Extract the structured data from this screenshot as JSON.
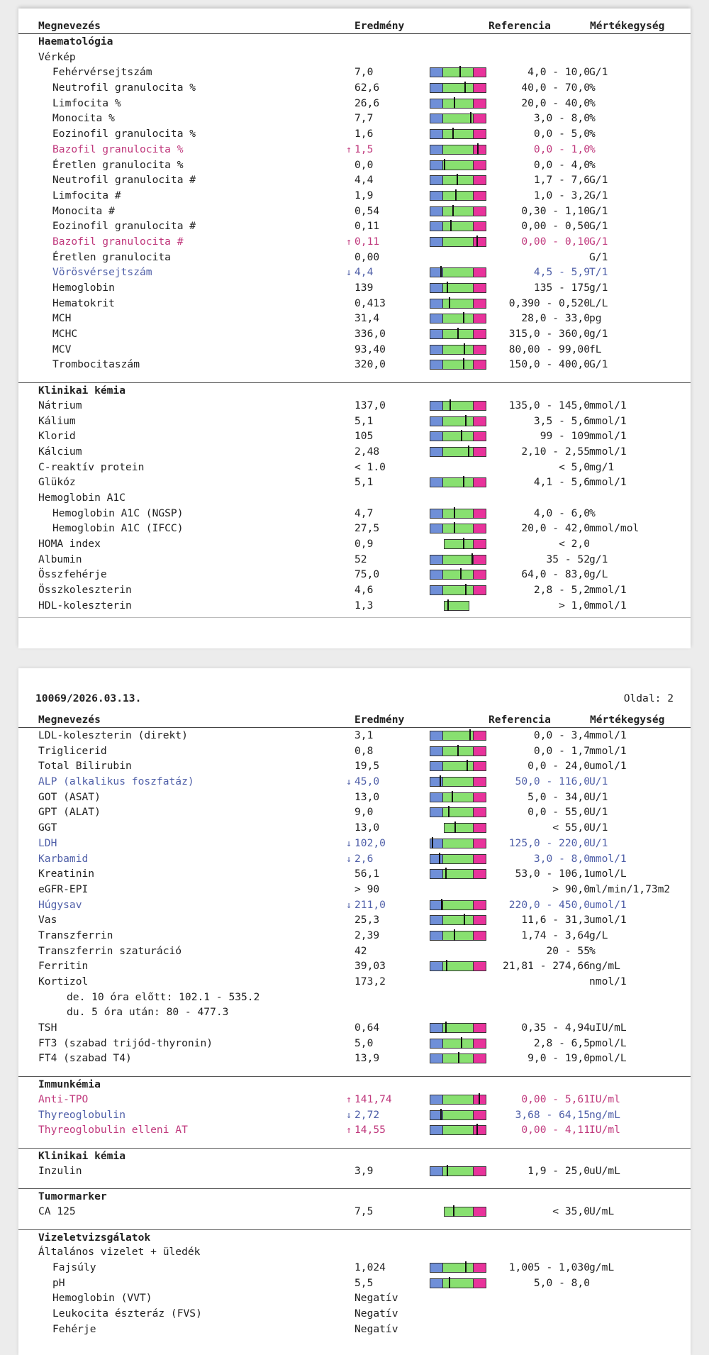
{
  "columns": {
    "name": "Megnevezés",
    "result": "Eredmény",
    "reference": "Referencia",
    "unit": "Mértékegység"
  },
  "page1": {
    "rows": [
      {
        "kind": "category",
        "name": "Haematológia"
      },
      {
        "kind": "group",
        "name": "Vérkép"
      },
      {
        "kind": "item",
        "indent": 1,
        "name": "Fehérvérsejtszám",
        "result": "7,0",
        "ref": "4,0 - 10,0",
        "unit": "G/1",
        "bar": "full",
        "level": 0.55
      },
      {
        "kind": "item",
        "indent": 1,
        "name": "Neutrofil granulocita %",
        "result": "62,6",
        "ref": "40,0 - 70,0",
        "unit": "%",
        "bar": "full",
        "level": 0.73
      },
      {
        "kind": "item",
        "indent": 1,
        "name": "Limfocita %",
        "result": "26,6",
        "ref": "20,0 - 40,0",
        "unit": "%",
        "bar": "full",
        "level": 0.36
      },
      {
        "kind": "item",
        "indent": 1,
        "name": "Monocita %",
        "result": "7,7",
        "ref": "3,0 - 8,0",
        "unit": "%",
        "bar": "full",
        "level": 0.93
      },
      {
        "kind": "item",
        "indent": 1,
        "name": "Eozinofil granulocita %",
        "result": "1,6",
        "ref": "0,0 - 5,0",
        "unit": "%",
        "bar": "full",
        "level": 0.3
      },
      {
        "kind": "item",
        "indent": 1,
        "name": "Bazofil granulocita %",
        "result": "1,5",
        "ref": "0,0 - 1,0",
        "unit": "%",
        "bar": "full",
        "level": 1.1,
        "flag": "↑",
        "status": "high"
      },
      {
        "kind": "item",
        "indent": 1,
        "name": "Éretlen granulocita %",
        "result": "0,0",
        "ref": "0,0 - 4,0",
        "unit": "%",
        "bar": "full",
        "level": 0.0
      },
      {
        "kind": "item",
        "indent": 1,
        "name": "Neutrofil granulocita #",
        "result": "4,4",
        "ref": "1,7 - 7,6",
        "unit": "G/1",
        "bar": "full",
        "level": 0.46
      },
      {
        "kind": "item",
        "indent": 1,
        "name": "Limfocita #",
        "result": "1,9",
        "ref": "1,0 - 3,2",
        "unit": "G/1",
        "bar": "full",
        "level": 0.41
      },
      {
        "kind": "item",
        "indent": 1,
        "name": "Monocita #",
        "result": "0,54",
        "ref": "0,30 - 1,10",
        "unit": "G/1",
        "bar": "full",
        "level": 0.3
      },
      {
        "kind": "item",
        "indent": 1,
        "name": "Eozinofil granulocita #",
        "result": "0,11",
        "ref": "0,00 - 0,50",
        "unit": "G/1",
        "bar": "full",
        "level": 0.22
      },
      {
        "kind": "item",
        "indent": 1,
        "name": "Bazofil granulocita #",
        "result": "0,11",
        "ref": "0,00 - 0,10",
        "unit": "G/1",
        "bar": "full",
        "level": 1.08,
        "flag": "↑",
        "status": "high"
      },
      {
        "kind": "item",
        "indent": 1,
        "name": "Éretlen granulocita",
        "result": "0,00",
        "ref": "",
        "unit": "G/1",
        "bar": "none"
      },
      {
        "kind": "item",
        "indent": 1,
        "name": "Vörösvérsejtszám",
        "result": "4,4",
        "ref": "4,5 - 5,9",
        "unit": "T/1",
        "bar": "full",
        "level": -0.05,
        "flag": "↓",
        "status": "low"
      },
      {
        "kind": "item",
        "indent": 1,
        "name": "Hemoglobin",
        "result": "139",
        "ref": "135 - 175",
        "unit": "g/1",
        "bar": "full",
        "level": 0.1
      },
      {
        "kind": "item",
        "indent": 1,
        "name": "Hematokrit",
        "result": "0,413",
        "ref": "0,390 - 0,520",
        "unit": "L/L",
        "bar": "full",
        "level": 0.18
      },
      {
        "kind": "item",
        "indent": 1,
        "name": "MCH",
        "result": "31,4",
        "ref": "28,0 - 33,0",
        "unit": "pg",
        "bar": "full",
        "level": 0.68
      },
      {
        "kind": "item",
        "indent": 1,
        "name": "MCHC",
        "result": "336,0",
        "ref": "315,0 - 360,0",
        "unit": "g/1",
        "bar": "full",
        "level": 0.47
      },
      {
        "kind": "item",
        "indent": 1,
        "name": "MCV",
        "result": "93,40",
        "ref": "80,00 - 99,00",
        "unit": "fL",
        "bar": "full",
        "level": 0.7
      },
      {
        "kind": "item",
        "indent": 1,
        "name": "Trombocitaszám",
        "result": "320,0",
        "ref": "150,0 - 400,0",
        "unit": "G/1",
        "bar": "full",
        "level": 0.68
      },
      {
        "kind": "category",
        "name": "Klinikai kémia",
        "gap": true
      },
      {
        "kind": "item",
        "indent": 0,
        "name": "Nátrium",
        "result": "137,0",
        "ref": "135,0 - 145,0",
        "unit": "mmol/1",
        "bar": "full",
        "level": 0.2
      },
      {
        "kind": "item",
        "indent": 0,
        "name": "Kálium",
        "result": "5,1",
        "ref": "3,5 - 5,6",
        "unit": "mmol/1",
        "bar": "full",
        "level": 0.76
      },
      {
        "kind": "item",
        "indent": 0,
        "name": "Klorid",
        "result": "105",
        "ref": "99 - 109",
        "unit": "mmol/1",
        "bar": "full",
        "level": 0.6
      },
      {
        "kind": "item",
        "indent": 0,
        "name": "Kálcium",
        "result": "2,48",
        "ref": "2,10 - 2,55",
        "unit": "mmol/1",
        "bar": "full",
        "level": 0.84
      },
      {
        "kind": "item",
        "indent": 0,
        "name": "C-reaktív protein",
        "result": "< 1.0",
        "ref": "< 5,0",
        "unit": "mg/1",
        "bar": "none"
      },
      {
        "kind": "item",
        "indent": 0,
        "name": "Glükóz",
        "result": "5,1",
        "ref": "4,1 - 5,6",
        "unit": "mmol/1",
        "bar": "full",
        "level": 0.67
      },
      {
        "kind": "group",
        "indent": 0,
        "name": "Hemoglobin A1C"
      },
      {
        "kind": "item",
        "indent": 1,
        "name": "Hemoglobin A1C (NGSP)",
        "result": "4,7",
        "ref": "4,0 - 6,0",
        "unit": "%",
        "bar": "full",
        "level": 0.35
      },
      {
        "kind": "item",
        "indent": 1,
        "name": "Hemoglobin A1C (IFCC)",
        "result": "27,5",
        "ref": "20,0 - 42,0",
        "unit": "mmol/mol",
        "bar": "full",
        "level": 0.34
      },
      {
        "kind": "item",
        "indent": 0,
        "name": "HOMA index",
        "result": "0,9",
        "ref": "< 2,0",
        "unit": "",
        "bar": "nolow",
        "level": 0.45
      },
      {
        "kind": "item",
        "indent": 0,
        "name": "Albumin",
        "result": "52",
        "ref": "35 - 52",
        "unit": "g/1",
        "bar": "full",
        "level": 0.98
      },
      {
        "kind": "item",
        "indent": 0,
        "name": "Összfehérje",
        "result": "75,0",
        "ref": "64,0 - 83,0",
        "unit": "g/L",
        "bar": "full",
        "level": 0.58
      },
      {
        "kind": "item",
        "indent": 0,
        "name": "Összkoleszterin",
        "result": "4,6",
        "ref": "2,8 - 5,2",
        "unit": "mmol/1",
        "bar": "full",
        "level": 0.75
      },
      {
        "kind": "item",
        "indent": 0,
        "name": "HDL-koleszterin",
        "result": "1,3",
        "ref": "> 1,0",
        "unit": "mmol/1",
        "bar": "nohigh",
        "level": 0.12
      }
    ]
  },
  "page2": {
    "doc_id": "10069/2026.03.13.",
    "page_label": "Oldal: 2",
    "rows": [
      {
        "kind": "item",
        "indent": 0,
        "name": "LDL-koleszterin (direkt)",
        "result": "3,1",
        "ref": "0,0 - 3,4",
        "unit": "mmol/1",
        "bar": "full",
        "level": 0.9
      },
      {
        "kind": "item",
        "indent": 0,
        "name": "Triglicerid",
        "result": "0,8",
        "ref": "0,0 - 1,7",
        "unit": "mmol/1",
        "bar": "full",
        "level": 0.47
      },
      {
        "kind": "item",
        "indent": 0,
        "name": "Total Bilirubin",
        "result": "19,5",
        "ref": "0,0 - 24,0",
        "unit": "umol/1",
        "bar": "full",
        "level": 0.8
      },
      {
        "kind": "item",
        "indent": 0,
        "name": "ALP (alkalikus foszfatáz)",
        "result": "45,0",
        "ref": "50,0 - 116,0",
        "unit": "U/1",
        "bar": "full",
        "level": -0.07,
        "flag": "↓",
        "status": "low"
      },
      {
        "kind": "item",
        "indent": 0,
        "name": "GOT (ASAT)",
        "result": "13,0",
        "ref": "5,0 - 34,0",
        "unit": "U/1",
        "bar": "full",
        "level": 0.27
      },
      {
        "kind": "item",
        "indent": 0,
        "name": "GPT (ALAT)",
        "result": "9,0",
        "ref": "0,0 - 55,0",
        "unit": "U/1",
        "bar": "full",
        "level": 0.16
      },
      {
        "kind": "item",
        "indent": 0,
        "name": "GGT",
        "result": "13,0",
        "ref": "< 55,0",
        "unit": "U/1",
        "bar": "nolow",
        "level": 0.24
      },
      {
        "kind": "item",
        "indent": 0,
        "name": "LDH",
        "result": "102,0",
        "ref": "125,0 - 220,0",
        "unit": "U/1",
        "bar": "full",
        "level": -0.22,
        "flag": "↓",
        "status": "low"
      },
      {
        "kind": "item",
        "indent": 0,
        "name": "Karbamid",
        "result": "2,6",
        "ref": "3,0 - 8,0",
        "unit": "mmol/1",
        "bar": "full",
        "level": -0.08,
        "flag": "↓",
        "status": "low"
      },
      {
        "kind": "item",
        "indent": 0,
        "name": "Kreatinin",
        "result": "56,1",
        "ref": "53,0 - 106,1",
        "unit": "umol/L",
        "bar": "full",
        "level": 0.06
      },
      {
        "kind": "item",
        "indent": 0,
        "name": "eGFR-EPI",
        "result": "> 90",
        "ref": "> 90,0",
        "unit": "ml/min/1,73m2",
        "bar": "none"
      },
      {
        "kind": "item",
        "indent": 0,
        "name": "Húgysav",
        "result": "211,0",
        "ref": "220,0 - 450,0",
        "unit": "umol/1",
        "bar": "full",
        "level": -0.04,
        "flag": "↓",
        "status": "low"
      },
      {
        "kind": "item",
        "indent": 0,
        "name": "Vas",
        "result": "25,3",
        "ref": "11,6 - 31,3",
        "unit": "umol/1",
        "bar": "full",
        "level": 0.7
      },
      {
        "kind": "item",
        "indent": 0,
        "name": "Transzferrin",
        "result": "2,39",
        "ref": "1,74 - 3,64",
        "unit": "g/L",
        "bar": "full",
        "level": 0.34
      },
      {
        "kind": "item",
        "indent": 0,
        "name": "Transzferrin szaturáció",
        "result": "42",
        "ref": "20 - 55",
        "unit": "%",
        "bar": "none"
      },
      {
        "kind": "item",
        "indent": 0,
        "name": "Ferritin",
        "result": "39,03",
        "ref": "21,81 - 274,66",
        "unit": "ng/mL",
        "bar": "full",
        "level": 0.07
      },
      {
        "kind": "item",
        "indent": 0,
        "name": "Kortizol",
        "result": "173,2",
        "ref": "",
        "unit": "nmol/1",
        "bar": "none"
      },
      {
        "kind": "note",
        "text": "de. 10 óra előtt: 102.1 - 535.2"
      },
      {
        "kind": "note",
        "text": "du. 5 óra után: 80 - 477.3"
      },
      {
        "kind": "item",
        "indent": 0,
        "name": "TSH",
        "result": "0,64",
        "ref": "0,35 - 4,94",
        "unit": "uIU/mL",
        "bar": "full",
        "level": 0.06
      },
      {
        "kind": "item",
        "indent": 0,
        "name": "FT3 (szabad trijód-thyronin)",
        "result": "5,0",
        "ref": "2,8 - 6,5",
        "unit": "pmol/L",
        "bar": "full",
        "level": 0.59
      },
      {
        "kind": "item",
        "indent": 0,
        "name": "FT4 (szabad T4)",
        "result": "13,9",
        "ref": "9,0 - 19,0",
        "unit": "pmol/L",
        "bar": "full",
        "level": 0.49
      },
      {
        "kind": "category",
        "name": "Immunkémia",
        "gap": true
      },
      {
        "kind": "item",
        "indent": 0,
        "name": "Anti-TPO",
        "result": "141,74",
        "ref": "0,00 - 5,61",
        "unit": "IU/ml",
        "bar": "full",
        "level": 1.12,
        "flag": "↑",
        "status": "high"
      },
      {
        "kind": "item",
        "indent": 0,
        "name": "Thyreoglobulin",
        "result": "2,72",
        "ref": "3,68 - 64,15",
        "unit": "ng/mL",
        "bar": "full",
        "level": -0.05,
        "flag": "↓",
        "status": "low"
      },
      {
        "kind": "item",
        "indent": 0,
        "name": "Thyreoglobulin elleni AT",
        "result": "14,55",
        "ref": "0,00 - 4,11",
        "unit": "IU/ml",
        "bar": "full",
        "level": 1.08,
        "flag": "↑",
        "status": "high"
      },
      {
        "kind": "category",
        "name": "Klinikai kémia",
        "gap": true
      },
      {
        "kind": "item",
        "indent": 0,
        "name": "Inzulin",
        "result": "3,9",
        "ref": "1,9 - 25,0",
        "unit": "uU/mL",
        "bar": "full",
        "level": 0.09
      },
      {
        "kind": "category",
        "name": "Tumormarker",
        "gap": true
      },
      {
        "kind": "item",
        "indent": 0,
        "name": "CA 125",
        "result": "7,5",
        "ref": "< 35,0",
        "unit": "U/mL",
        "bar": "nolow",
        "level": 0.21
      },
      {
        "kind": "category",
        "name": "Vizeletvizsgálatok",
        "gap": true
      },
      {
        "kind": "group",
        "indent": 0,
        "name": "Általános vizelet + üledék"
      },
      {
        "kind": "item",
        "indent": 1,
        "name": "Fajsúly",
        "result": "1,024",
        "ref": "1,005 - 1,030",
        "unit": "g/mL",
        "bar": "full",
        "level": 0.76
      },
      {
        "kind": "item",
        "indent": 1,
        "name": "pH",
        "result": "5,5",
        "ref": "5,0 - 8,0",
        "unit": "",
        "bar": "full",
        "level": 0.17
      },
      {
        "kind": "item",
        "indent": 1,
        "name": "Hemoglobin (VVT)",
        "result": "Negatív",
        "ref": "",
        "unit": "",
        "bar": "none"
      },
      {
        "kind": "item",
        "indent": 1,
        "name": "Leukocita észteráz (FVS)",
        "result": "Negatív",
        "ref": "",
        "unit": "",
        "bar": "none"
      },
      {
        "kind": "item",
        "indent": 1,
        "name": "Fehérje",
        "result": "Negatív",
        "ref": "",
        "unit": "",
        "bar": "none"
      }
    ]
  }
}
